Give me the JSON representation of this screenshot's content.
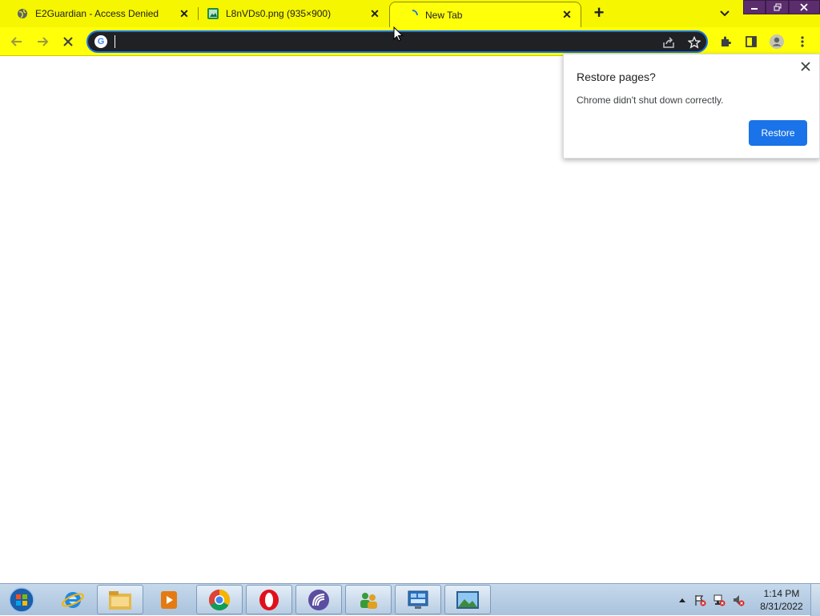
{
  "tabs": [
    {
      "title": "E2Guardian - Access Denied",
      "icon": "globe-icon"
    },
    {
      "title": "L8nVDs0.png (935×900)",
      "icon": "image-icon"
    },
    {
      "title": "New Tab",
      "icon": "loading-spinner-icon",
      "active": true
    }
  ],
  "omnibox": {
    "value": "",
    "placeholder": ""
  },
  "restore_bubble": {
    "title": "Restore pages?",
    "message": "Chrome didn't shut down correctly.",
    "button": "Restore"
  },
  "clock": {
    "time": "1:14 PM",
    "date": "8/31/2022"
  },
  "taskbar": {
    "items": [
      "start-orb-icon",
      "internet-explorer-icon",
      "file-explorer-icon",
      "media-player-icon",
      "chrome-icon",
      "opera-icon",
      "bittorrent-icon",
      "users-icon",
      "control-panel-icon",
      "photo-viewer-icon"
    ]
  },
  "colors": {
    "tabstrip": "#f6f600",
    "toolbar": "#ffff0a",
    "accent": "#1a73e8",
    "omnibox_bg": "#202124"
  }
}
